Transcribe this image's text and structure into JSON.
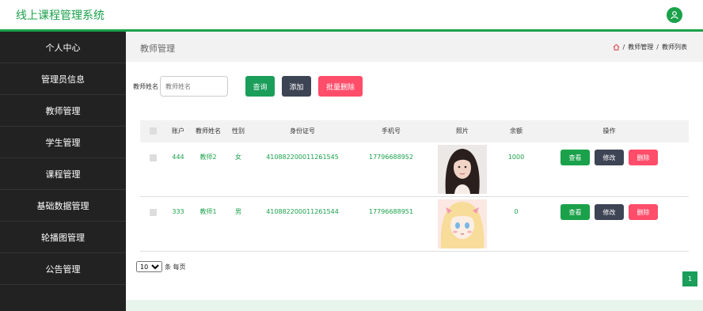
{
  "app": {
    "title": "线上课程管理系统"
  },
  "colors": {
    "primary": "#1aa14a",
    "dark": "#3d4454",
    "danger": "#ff4d6a",
    "sidebar": "#222222"
  },
  "sidebar": {
    "items": [
      {
        "label": "个人中心"
      },
      {
        "label": "管理员信息"
      },
      {
        "label": "教师管理"
      },
      {
        "label": "学生管理"
      },
      {
        "label": "课程管理"
      },
      {
        "label": "基础数据管理"
      },
      {
        "label": "轮播图管理"
      },
      {
        "label": "公告管理"
      }
    ]
  },
  "page": {
    "title": "教师管理",
    "breadcrumb": {
      "home_icon": "home-icon",
      "sep": "/",
      "parent": "教师管理",
      "current": "教师列表"
    }
  },
  "search": {
    "label": "教师姓名",
    "placeholder": "教师姓名",
    "value": ""
  },
  "toolbar": {
    "query_label": "查询",
    "add_label": "添加",
    "batch_delete_label": "批量删除"
  },
  "table": {
    "columns": {
      "account": "账户",
      "name": "教师姓名",
      "gender": "性别",
      "id_number": "身份证号",
      "phone": "手机号",
      "photo": "照片",
      "balance": "余额",
      "actions": "操作"
    },
    "rows": [
      {
        "account": "444",
        "name": "教师2",
        "gender": "女",
        "id_number": "410882200011261545",
        "phone": "17796688952",
        "balance": "1000"
      },
      {
        "account": "333",
        "name": "教师1",
        "gender": "男",
        "id_number": "410882200011261544",
        "phone": "17796688951",
        "balance": "0"
      }
    ],
    "actions": {
      "view": "查看",
      "edit": "修改",
      "delete": "删除"
    }
  },
  "pagination": {
    "page_size": "10",
    "per_page_suffix": "条 每页",
    "current_page": "1"
  }
}
